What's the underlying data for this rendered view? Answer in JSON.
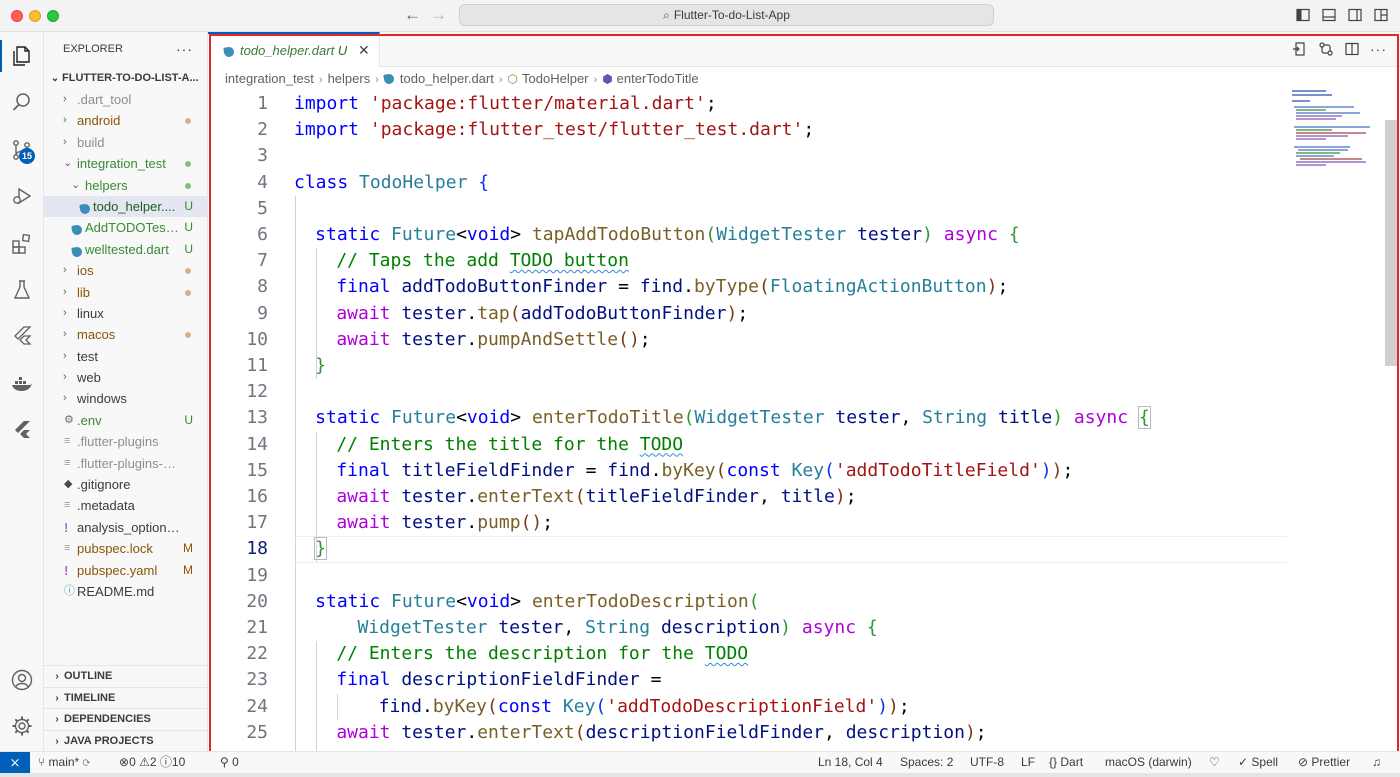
{
  "window": {
    "search_text": "Flutter-To-do-List-App"
  },
  "activity": {
    "scm_badge": "15"
  },
  "sidebar": {
    "header": "EXPLORER",
    "more": "···",
    "root": "FLUTTER-TO-DO-LIST-A...",
    "items": [
      {
        "label": ".dart_tool",
        "kind": "folder",
        "depth": 0,
        "color": "grey",
        "decoration": ""
      },
      {
        "label": "android",
        "kind": "folder",
        "depth": 0,
        "color": "olive",
        "decoration": "dot-olive"
      },
      {
        "label": "build",
        "kind": "folder",
        "depth": 0,
        "color": "grey",
        "decoration": ""
      },
      {
        "label": "integration_test",
        "kind": "folder-open",
        "depth": 0,
        "color": "green",
        "decoration": "dot-green"
      },
      {
        "label": "helpers",
        "kind": "folder-open",
        "depth": 1,
        "color": "green",
        "decoration": "dot-green"
      },
      {
        "label": "todo_helper....",
        "kind": "dart",
        "depth": 2,
        "color": "green",
        "decoration": "U"
      },
      {
        "label": "AddTODOTest...",
        "kind": "dart",
        "depth": 1,
        "color": "green",
        "decoration": "U"
      },
      {
        "label": "welltested.dart",
        "kind": "dart",
        "depth": 1,
        "color": "green",
        "decoration": "U"
      },
      {
        "label": "ios",
        "kind": "folder",
        "depth": 0,
        "color": "olive",
        "decoration": "dot-olive"
      },
      {
        "label": "lib",
        "kind": "folder",
        "depth": 0,
        "color": "olive",
        "decoration": "dot-olive"
      },
      {
        "label": "linux",
        "kind": "folder",
        "depth": 0,
        "color": "plain",
        "decoration": ""
      },
      {
        "label": "macos",
        "kind": "folder",
        "depth": 0,
        "color": "olive",
        "decoration": "dot-olive"
      },
      {
        "label": "test",
        "kind": "folder",
        "depth": 0,
        "color": "plain",
        "decoration": ""
      },
      {
        "label": "web",
        "kind": "folder",
        "depth": 0,
        "color": "plain",
        "decoration": ""
      },
      {
        "label": "windows",
        "kind": "folder",
        "depth": 0,
        "color": "plain",
        "decoration": ""
      },
      {
        "label": ".env",
        "kind": "gear",
        "depth": 0,
        "color": "green",
        "decoration": "U"
      },
      {
        "label": ".flutter-plugins",
        "kind": "lines",
        "depth": 0,
        "color": "grey",
        "decoration": ""
      },
      {
        "label": ".flutter-plugins-dep...",
        "kind": "lines",
        "depth": 0,
        "color": "grey",
        "decoration": ""
      },
      {
        "label": ".gitignore",
        "kind": "git",
        "depth": 0,
        "color": "plain",
        "decoration": ""
      },
      {
        "label": ".metadata",
        "kind": "lines",
        "depth": 0,
        "color": "plain",
        "decoration": ""
      },
      {
        "label": "analysis_options.yaml",
        "kind": "yaml",
        "depth": 0,
        "color": "plain",
        "decoration": ""
      },
      {
        "label": "pubspec.lock",
        "kind": "lines",
        "depth": 0,
        "color": "olive",
        "decoration": "M"
      },
      {
        "label": "pubspec.yaml",
        "kind": "yaml",
        "depth": 0,
        "color": "olive",
        "decoration": "M"
      },
      {
        "label": "README.md",
        "kind": "info",
        "depth": 0,
        "color": "plain",
        "decoration": ""
      }
    ],
    "sections": [
      "OUTLINE",
      "TIMELINE",
      "DEPENDENCIES",
      "JAVA PROJECTS"
    ]
  },
  "editor": {
    "tab": {
      "name": "todo_helper.dart",
      "status": "U",
      "close": "✕"
    },
    "breadcrumb": [
      "integration_test",
      "helpers",
      "todo_helper.dart",
      "TodoHelper",
      "enterTodoTitle"
    ],
    "current_line": 18,
    "lines": [
      {
        "n": "1",
        "indent": 0,
        "t": [
          [
            "kw",
            "import"
          ],
          [
            "pl",
            " "
          ],
          [
            "str",
            "'package:flutter/material.dart'"
          ],
          [
            "pl",
            ";"
          ]
        ]
      },
      {
        "n": "2",
        "indent": 0,
        "t": [
          [
            "kw",
            "import"
          ],
          [
            "pl",
            " "
          ],
          [
            "str",
            "'package:flutter_test/flutter_test.dart'"
          ],
          [
            "pl",
            ";"
          ]
        ]
      },
      {
        "n": "3",
        "indent": 0,
        "t": []
      },
      {
        "n": "4",
        "indent": 0,
        "t": [
          [
            "kw",
            "class"
          ],
          [
            "pl",
            " "
          ],
          [
            "cls",
            "TodoHelper"
          ],
          [
            "pl",
            " "
          ],
          [
            "br1",
            "{"
          ]
        ]
      },
      {
        "n": "5",
        "indent": 0,
        "t": []
      },
      {
        "n": "6",
        "indent": 1,
        "t": [
          [
            "kw",
            "static"
          ],
          [
            "pl",
            " "
          ],
          [
            "cls",
            "Future"
          ],
          [
            "pl",
            "<"
          ],
          [
            "kw",
            "void"
          ],
          [
            "pl",
            "> "
          ],
          [
            "fn",
            "tapAddTodoButton"
          ],
          [
            "br2",
            "("
          ],
          [
            "cls",
            "WidgetTester"
          ],
          [
            "pl",
            " "
          ],
          [
            "var",
            "tester"
          ],
          [
            "br2",
            ")"
          ],
          [
            "pl",
            " "
          ],
          [
            "kp",
            "async"
          ],
          [
            "pl",
            " "
          ],
          [
            "br2",
            "{"
          ]
        ]
      },
      {
        "n": "7",
        "indent": 2,
        "t": [
          [
            "cm",
            "// Taps the add "
          ],
          [
            "cmsq",
            "TODO button"
          ]
        ]
      },
      {
        "n": "8",
        "indent": 2,
        "t": [
          [
            "kw",
            "final"
          ],
          [
            "pl",
            " "
          ],
          [
            "var",
            "addTodoButtonFinder"
          ],
          [
            "pl",
            " = "
          ],
          [
            "var",
            "find"
          ],
          [
            "pl",
            "."
          ],
          [
            "fn",
            "byType"
          ],
          [
            "br3",
            "("
          ],
          [
            "cls",
            "FloatingActionButton"
          ],
          [
            "br3",
            ")"
          ],
          [
            "pl",
            ";"
          ]
        ]
      },
      {
        "n": "9",
        "indent": 2,
        "t": [
          [
            "kp",
            "await"
          ],
          [
            "pl",
            " "
          ],
          [
            "var",
            "tester"
          ],
          [
            "pl",
            "."
          ],
          [
            "fn",
            "tap"
          ],
          [
            "br3",
            "("
          ],
          [
            "var",
            "addTodoButtonFinder"
          ],
          [
            "br3",
            ")"
          ],
          [
            "pl",
            ";"
          ]
        ]
      },
      {
        "n": "10",
        "indent": 2,
        "t": [
          [
            "kp",
            "await"
          ],
          [
            "pl",
            " "
          ],
          [
            "var",
            "tester"
          ],
          [
            "pl",
            "."
          ],
          [
            "fn",
            "pumpAndSettle"
          ],
          [
            "br3",
            "()"
          ],
          [
            "pl",
            ";"
          ]
        ]
      },
      {
        "n": "11",
        "indent": 1,
        "t": [
          [
            "br2",
            "}"
          ]
        ]
      },
      {
        "n": "12",
        "indent": 0,
        "t": []
      },
      {
        "n": "13",
        "indent": 1,
        "t": [
          [
            "kw",
            "static"
          ],
          [
            "pl",
            " "
          ],
          [
            "cls",
            "Future"
          ],
          [
            "pl",
            "<"
          ],
          [
            "kw",
            "void"
          ],
          [
            "pl",
            "> "
          ],
          [
            "fn",
            "enterTodoTitle"
          ],
          [
            "br2",
            "("
          ],
          [
            "cls",
            "WidgetTester"
          ],
          [
            "pl",
            " "
          ],
          [
            "var",
            "tester"
          ],
          [
            "pl",
            ", "
          ],
          [
            "cls",
            "String"
          ],
          [
            "pl",
            " "
          ],
          [
            "var",
            "title"
          ],
          [
            "br2",
            ")"
          ],
          [
            "pl",
            " "
          ],
          [
            "kp",
            "async"
          ],
          [
            "pl",
            " "
          ],
          [
            "br2hl",
            "{"
          ]
        ]
      },
      {
        "n": "14",
        "indent": 2,
        "t": [
          [
            "cm",
            "// Enters the title for the "
          ],
          [
            "cmsq",
            "TODO"
          ]
        ]
      },
      {
        "n": "15",
        "indent": 2,
        "t": [
          [
            "kw",
            "final"
          ],
          [
            "pl",
            " "
          ],
          [
            "var",
            "titleFieldFinder"
          ],
          [
            "pl",
            " = "
          ],
          [
            "var",
            "find"
          ],
          [
            "pl",
            "."
          ],
          [
            "fn",
            "byKey"
          ],
          [
            "br3",
            "("
          ],
          [
            "kw",
            "const"
          ],
          [
            "pl",
            " "
          ],
          [
            "cls",
            "Key"
          ],
          [
            "br1",
            "("
          ],
          [
            "str",
            "'addTodoTitleField'"
          ],
          [
            "br1",
            ")"
          ],
          [
            "br3",
            ")"
          ],
          [
            "pl",
            ";"
          ]
        ]
      },
      {
        "n": "16",
        "indent": 2,
        "t": [
          [
            "kp",
            "await"
          ],
          [
            "pl",
            " "
          ],
          [
            "var",
            "tester"
          ],
          [
            "pl",
            "."
          ],
          [
            "fn",
            "enterText"
          ],
          [
            "br3",
            "("
          ],
          [
            "var",
            "titleFieldFinder"
          ],
          [
            "pl",
            ", "
          ],
          [
            "var",
            "title"
          ],
          [
            "br3",
            ")"
          ],
          [
            "pl",
            ";"
          ]
        ]
      },
      {
        "n": "17",
        "indent": 2,
        "t": [
          [
            "kp",
            "await"
          ],
          [
            "pl",
            " "
          ],
          [
            "var",
            "tester"
          ],
          [
            "pl",
            "."
          ],
          [
            "fn",
            "pump"
          ],
          [
            "br3",
            "()"
          ],
          [
            "pl",
            ";"
          ]
        ]
      },
      {
        "n": "18",
        "indent": 1,
        "t": [
          [
            "br2hl",
            "}"
          ]
        ]
      },
      {
        "n": "19",
        "indent": 0,
        "t": []
      },
      {
        "n": "20",
        "indent": 1,
        "t": [
          [
            "kw",
            "static"
          ],
          [
            "pl",
            " "
          ],
          [
            "cls",
            "Future"
          ],
          [
            "pl",
            "<"
          ],
          [
            "kw",
            "void"
          ],
          [
            "pl",
            "> "
          ],
          [
            "fn",
            "enterTodoDescription"
          ],
          [
            "br2",
            "("
          ]
        ]
      },
      {
        "n": "21",
        "indent": 3,
        "t": [
          [
            "cls",
            "WidgetTester"
          ],
          [
            "pl",
            " "
          ],
          [
            "var",
            "tester"
          ],
          [
            "pl",
            ", "
          ],
          [
            "cls",
            "String"
          ],
          [
            "pl",
            " "
          ],
          [
            "var",
            "description"
          ],
          [
            "br2",
            ")"
          ],
          [
            "pl",
            " "
          ],
          [
            "kp",
            "async"
          ],
          [
            "pl",
            " "
          ],
          [
            "br2",
            "{"
          ]
        ]
      },
      {
        "n": "22",
        "indent": 2,
        "t": [
          [
            "cm",
            "// Enters the description for the "
          ],
          [
            "cmsq",
            "TODO"
          ]
        ]
      },
      {
        "n": "23",
        "indent": 2,
        "t": [
          [
            "kw",
            "final"
          ],
          [
            "pl",
            " "
          ],
          [
            "var",
            "descriptionFieldFinder"
          ],
          [
            "pl",
            " ="
          ]
        ]
      },
      {
        "n": "24",
        "indent": 4,
        "t": [
          [
            "var",
            "find"
          ],
          [
            "pl",
            "."
          ],
          [
            "fn",
            "byKey"
          ],
          [
            "br3",
            "("
          ],
          [
            "kw",
            "const"
          ],
          [
            "pl",
            " "
          ],
          [
            "cls",
            "Key"
          ],
          [
            "br1",
            "("
          ],
          [
            "str",
            "'addTodoDescriptionField'"
          ],
          [
            "br1",
            ")"
          ],
          [
            "br3",
            ")"
          ],
          [
            "pl",
            ";"
          ]
        ]
      },
      {
        "n": "25",
        "indent": 2,
        "t": [
          [
            "kp",
            "await"
          ],
          [
            "pl",
            " "
          ],
          [
            "var",
            "tester"
          ],
          [
            "pl",
            "."
          ],
          [
            "fn",
            "enterText"
          ],
          [
            "br3",
            "("
          ],
          [
            "var",
            "descriptionFieldFinder"
          ],
          [
            "pl",
            ", "
          ],
          [
            "var",
            "description"
          ],
          [
            "br3",
            ")"
          ],
          [
            "pl",
            ";"
          ]
        ]
      }
    ]
  },
  "status": {
    "branch": "main*",
    "errors": "0",
    "warnings": "2",
    "info": "10",
    "ports": "0",
    "position": "Ln 18, Col 4",
    "spaces": "Spaces: 2",
    "encoding": "UTF-8",
    "eol": "LF",
    "language": "Dart",
    "device": "macOS (darwin)",
    "spell": "Spell",
    "prettier": "Prettier"
  },
  "colors": {
    "accent": "#005fb8",
    "frame": "#e2262a",
    "untracked": "#388a34",
    "modified": "#895503"
  }
}
